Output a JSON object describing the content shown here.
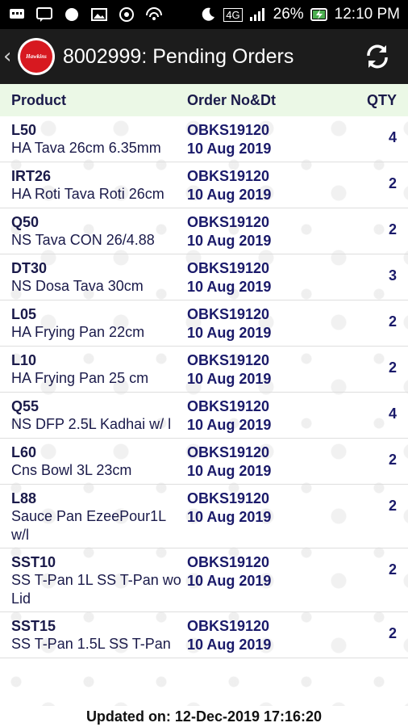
{
  "status_bar": {
    "battery": "26%",
    "time": "12:10 PM",
    "network": "4G"
  },
  "header": {
    "logo_text": "Hawkins",
    "title": "8002999: Pending Orders"
  },
  "table": {
    "columns": {
      "product": "Product",
      "order": "Order No&Dt",
      "qty": "QTY"
    },
    "rows": [
      {
        "code": "L50",
        "name": "HA Tava 26cm 6.35mm",
        "order_no": "OBKS19120",
        "order_date": "10 Aug 2019",
        "qty": "4"
      },
      {
        "code": "IRT26",
        "name": "HA Roti Tava Roti 26cm",
        "order_no": "OBKS19120",
        "order_date": "10 Aug 2019",
        "qty": "2"
      },
      {
        "code": "Q50",
        "name": "NS Tava CON 26/4.88",
        "order_no": "OBKS19120",
        "order_date": "10 Aug 2019",
        "qty": "2"
      },
      {
        "code": "DT30",
        "name": "NS Dosa Tava 30cm",
        "order_no": "OBKS19120",
        "order_date": "10 Aug 2019",
        "qty": "3"
      },
      {
        "code": "L05",
        "name": "HA Frying Pan 22cm",
        "order_no": "OBKS19120",
        "order_date": "10 Aug 2019",
        "qty": "2"
      },
      {
        "code": "L10",
        "name": "HA Frying Pan 25 cm",
        "order_no": "OBKS19120",
        "order_date": "10 Aug 2019",
        "qty": "2"
      },
      {
        "code": "Q55",
        "name": "NS DFP 2.5L Kadhai w/ l",
        "order_no": "OBKS19120",
        "order_date": "10 Aug 2019",
        "qty": "4"
      },
      {
        "code": "L60",
        "name": "Cns Bowl 3L 23cm",
        "order_no": "OBKS19120",
        "order_date": "10 Aug 2019",
        "qty": "2"
      },
      {
        "code": "L88",
        "name": "Sauce Pan EzeePour1L w/l",
        "order_no": "OBKS19120",
        "order_date": "10 Aug 2019",
        "qty": "2"
      },
      {
        "code": "SST10",
        "name": "SS T-Pan 1L SS  T-Pan wo Lid",
        "order_no": "OBKS19120",
        "order_date": "10 Aug 2019",
        "qty": "2"
      },
      {
        "code": "SST15",
        "name": "SS T-Pan 1.5L SS T-Pan",
        "order_no": "OBKS19120",
        "order_date": "10 Aug 2019",
        "qty": "2"
      }
    ]
  },
  "footer": {
    "updated": "Updated on: 12-Dec-2019 17:16:20"
  }
}
